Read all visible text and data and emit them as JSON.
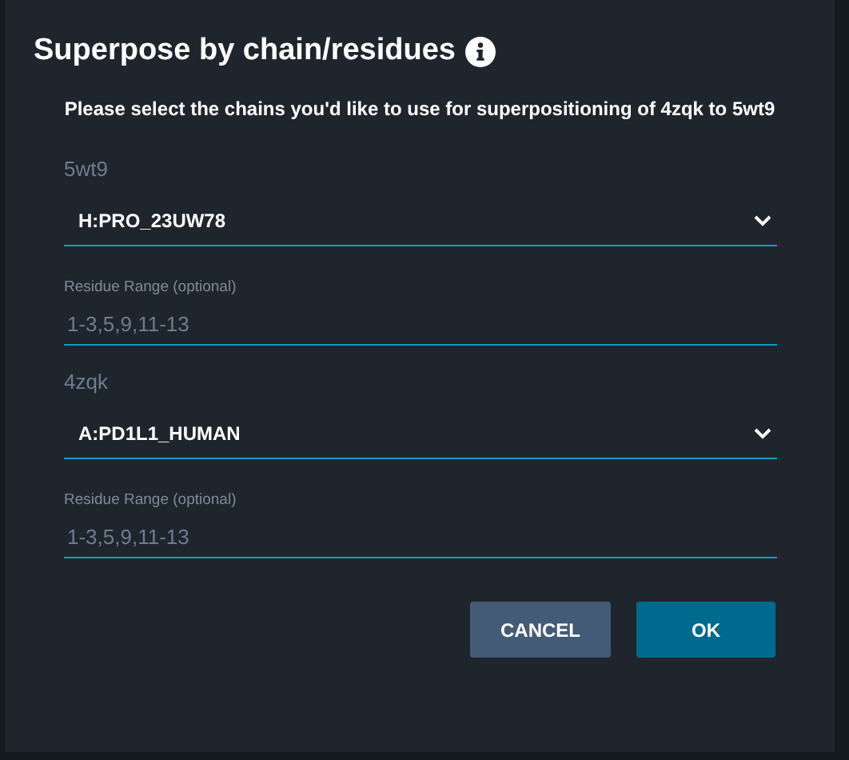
{
  "dialog": {
    "title": "Superpose by chain/residues",
    "instructions": "Please select the chains you'd like to use for superpositioning of 4zqk to 5wt9",
    "structures": [
      {
        "name": "5wt9",
        "chain": "H:PRO_23UW78",
        "range_label": "Residue Range (optional)",
        "range_placeholder": "1-3,5,9,11-13"
      },
      {
        "name": "4zqk",
        "chain": "A:PD1L1_HUMAN",
        "range_label": "Residue Range (optional)",
        "range_placeholder": "1-3,5,9,11-13"
      }
    ],
    "buttons": [
      {
        "label": "CANCEL",
        "kind": "secondary"
      },
      {
        "label": "OK",
        "kind": "primary"
      }
    ]
  }
}
